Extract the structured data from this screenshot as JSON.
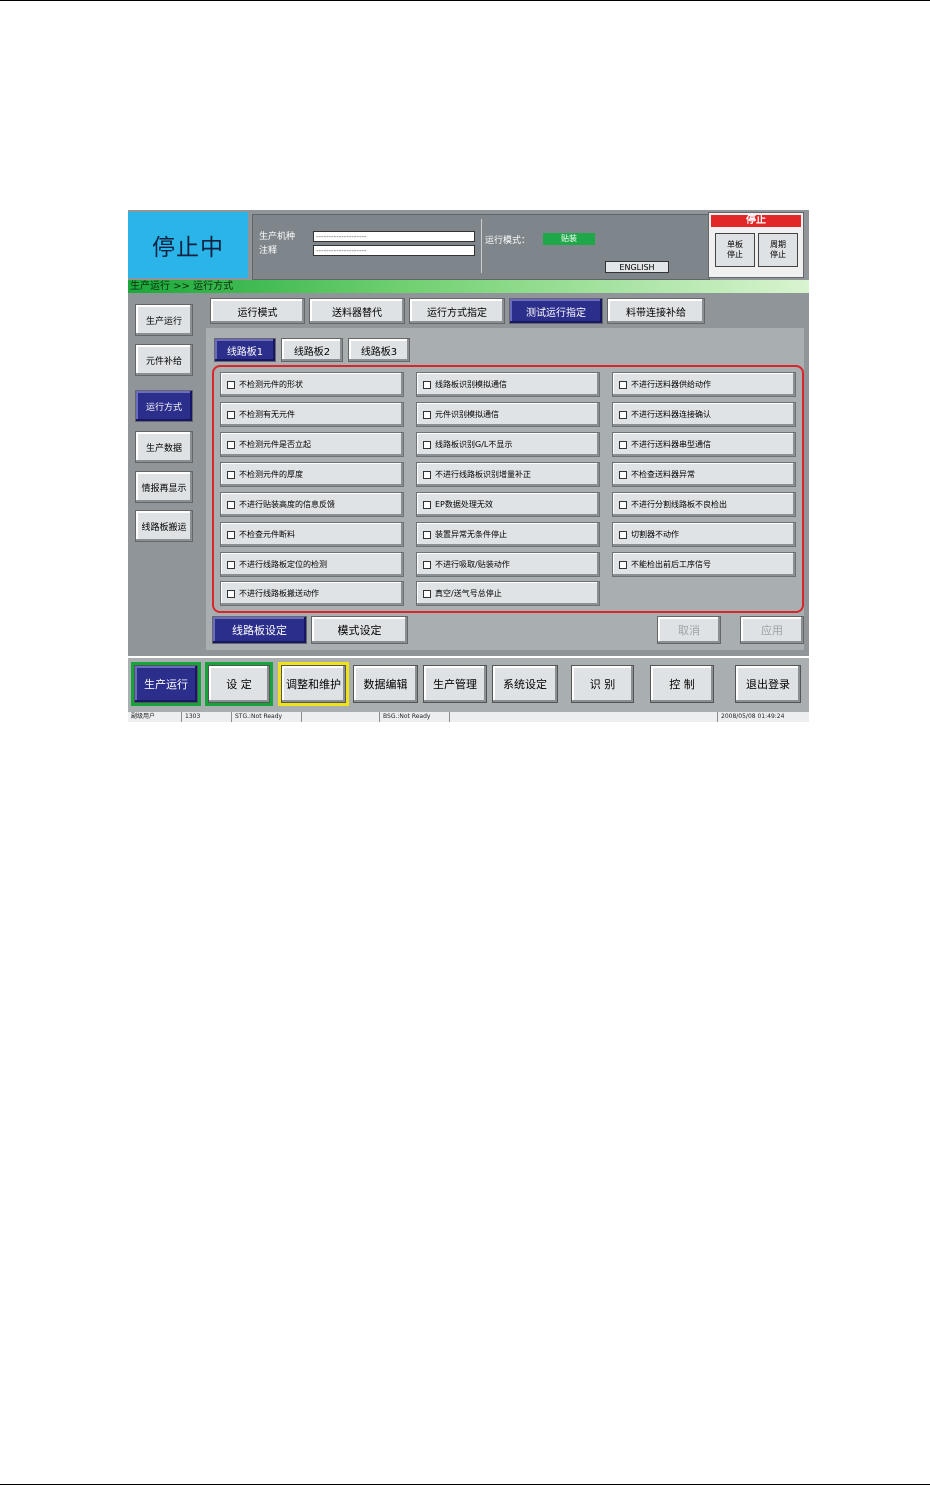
{
  "header": {
    "status": "停止中",
    "product_label": "生产机种",
    "product_value": "--------------------",
    "comment_label": "注释",
    "comment_value": "--------------------",
    "mode_label": "运行模式：",
    "mode_value": "贴装",
    "english_button": "ENGLISH",
    "stop_title": "停止",
    "stop_single": "单板\n停止",
    "stop_cycle": "周期\n停止"
  },
  "breadcrumb": "生产运行  >>  运行方式",
  "sidebar": [
    "生产运行",
    "元件补给",
    "运行方式",
    "生产数据",
    "情报再显示",
    "线路板搬运"
  ],
  "top_tabs": [
    "运行模式",
    "送料器替代",
    "运行方式指定",
    "测试运行指定",
    "料带连接补给"
  ],
  "board_tabs": [
    "线路板1",
    "线路板2",
    "线路板3"
  ],
  "options": {
    "col1": [
      "不检测元件的形状",
      "不检测有无元件",
      "不检测元件是否立起",
      "不检测元件的厚度",
      "不进行贴装高度的信息反馈",
      "不检查元件断料",
      "不进行线路板定位的检测",
      "不进行线路板搬送动作"
    ],
    "col2": [
      "线路板识别模拟通信",
      "元件识别模拟通信",
      "线路板识别G/L不显示",
      "不进行线路板识别增量补正",
      "EP数据处理无效",
      "装置异常无条件停止",
      "不进行吸取/贴装动作",
      "真空/送气号总停止"
    ],
    "col3": [
      "不进行送料器供给动作",
      "不进行送料器连接确认",
      "不进行送料器串型通信",
      "不检查送料器异常",
      "不进行分割线路板不良检出",
      "切割器不动作",
      "不能检出前后工序信号"
    ]
  },
  "bottom_tabs": {
    "board_setting": "线路板设定",
    "mode_setting": "模式设定",
    "cancel": "取消",
    "apply": "应用"
  },
  "main_buttons": [
    "生产运行",
    "设 定",
    "调整和维护",
    "数据编辑",
    "生产管理",
    "系统设定",
    "识 别",
    "控 制",
    "退出登录"
  ],
  "statusbar": [
    "副级用户",
    "1303",
    "STG.:Not Ready",
    "",
    "BSG.:Not Ready",
    "",
    "2008/05/08 01:49:24"
  ]
}
